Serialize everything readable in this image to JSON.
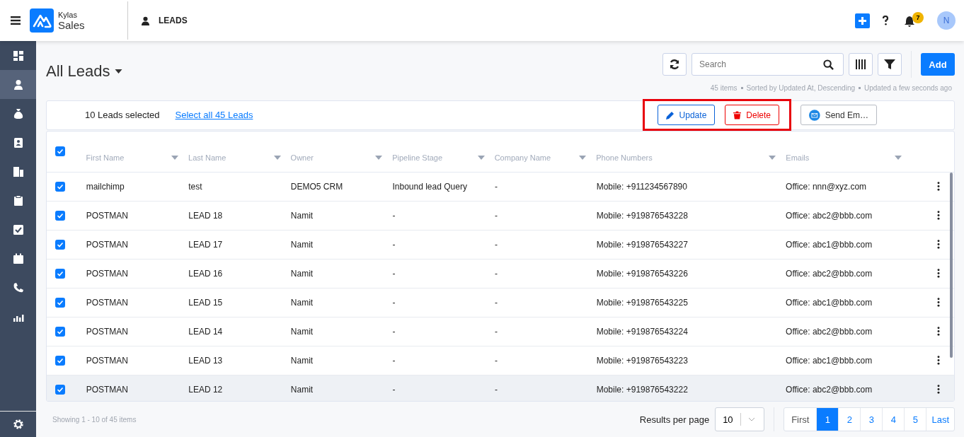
{
  "header": {
    "brand_top": "Kylas",
    "brand_bottom": "Sales",
    "module": "LEADS",
    "notification_count": "7",
    "avatar": "N"
  },
  "sidebar": {
    "items": [
      {
        "kind": "grid",
        "selected": false
      },
      {
        "kind": "person",
        "selected": true
      },
      {
        "kind": "moneybag",
        "selected": false
      },
      {
        "kind": "contact",
        "selected": false
      },
      {
        "kind": "building",
        "selected": false
      },
      {
        "kind": "clipboard",
        "selected": false
      },
      {
        "kind": "checkbox",
        "selected": false
      },
      {
        "kind": "calendar",
        "selected": false
      },
      {
        "kind": "phone",
        "selected": false
      },
      {
        "kind": "chart",
        "selected": false
      }
    ],
    "footer": {
      "kind": "gear",
      "selected": false
    }
  },
  "view_title": "All Leads",
  "search": {
    "placeholder": "Search"
  },
  "add_button": "Add",
  "summary": [
    "45 items",
    "Sorted by Updated At, Descending",
    "Updated a few seconds ago"
  ],
  "selection": {
    "count_text": "10 Leads selected",
    "select_all": "Select all 45 Leads"
  },
  "bulk_actions": {
    "highlighted": true,
    "buttons": [
      {
        "kind": "update",
        "label": "Update"
      },
      {
        "kind": "delete",
        "label": "Delete"
      }
    ]
  },
  "send_email": "Send Em…",
  "table": {
    "all_checked": true,
    "columns": [
      "First Name",
      "Last Name",
      "Owner",
      "Pipeline Stage",
      "Company Name",
      "Phone Numbers",
      "Emails"
    ],
    "rows": [
      {
        "checked": true,
        "highlighted": false,
        "cells": [
          "mailchimp",
          "test",
          "DEMO5 CRM",
          "Inbound lead Query",
          "-",
          "Mobile: +911234567890",
          "Office: nnn@xyz.com"
        ]
      },
      {
        "checked": true,
        "highlighted": false,
        "cells": [
          "POSTMAN",
          "LEAD 18",
          "Namit",
          "-",
          "-",
          "Mobile: +919876543228",
          "Office: abc2@bbb.com"
        ]
      },
      {
        "checked": true,
        "highlighted": false,
        "cells": [
          "POSTMAN",
          "LEAD 17",
          "Namit",
          "-",
          "-",
          "Mobile: +919876543227",
          "Office: abc1@bbb.com"
        ]
      },
      {
        "checked": true,
        "highlighted": false,
        "cells": [
          "POSTMAN",
          "LEAD 16",
          "Namit",
          "-",
          "-",
          "Mobile: +919876543226",
          "Office: abc2@bbb.com"
        ]
      },
      {
        "checked": true,
        "highlighted": false,
        "cells": [
          "POSTMAN",
          "LEAD 15",
          "Namit",
          "-",
          "-",
          "Mobile: +919876543225",
          "Office: abc1@bbb.com"
        ]
      },
      {
        "checked": true,
        "highlighted": false,
        "cells": [
          "POSTMAN",
          "LEAD 14",
          "Namit",
          "-",
          "-",
          "Mobile: +919876543224",
          "Office: abc2@bbb.com"
        ]
      },
      {
        "checked": true,
        "highlighted": false,
        "cells": [
          "POSTMAN",
          "LEAD 13",
          "Namit",
          "-",
          "-",
          "Mobile: +919876543223",
          "Office: abc1@bbb.com"
        ]
      },
      {
        "checked": true,
        "highlighted": true,
        "cells": [
          "POSTMAN",
          "LEAD 12",
          "Namit",
          "-",
          "-",
          "Mobile: +919876543222",
          "Office: abc2@bbb.com"
        ]
      }
    ]
  },
  "footer": {
    "showing": "Showing 1 - 10 of 45 items",
    "per_page_label": "Results per page",
    "per_page": "10",
    "pages": [
      {
        "label": "First",
        "selected": false
      },
      {
        "label": "1",
        "selected": true
      },
      {
        "label": "2",
        "selected": false
      },
      {
        "label": "3",
        "selected": false
      },
      {
        "label": "4",
        "selected": false
      },
      {
        "label": "5",
        "selected": false
      },
      {
        "label": "Last",
        "selected": false
      }
    ]
  }
}
